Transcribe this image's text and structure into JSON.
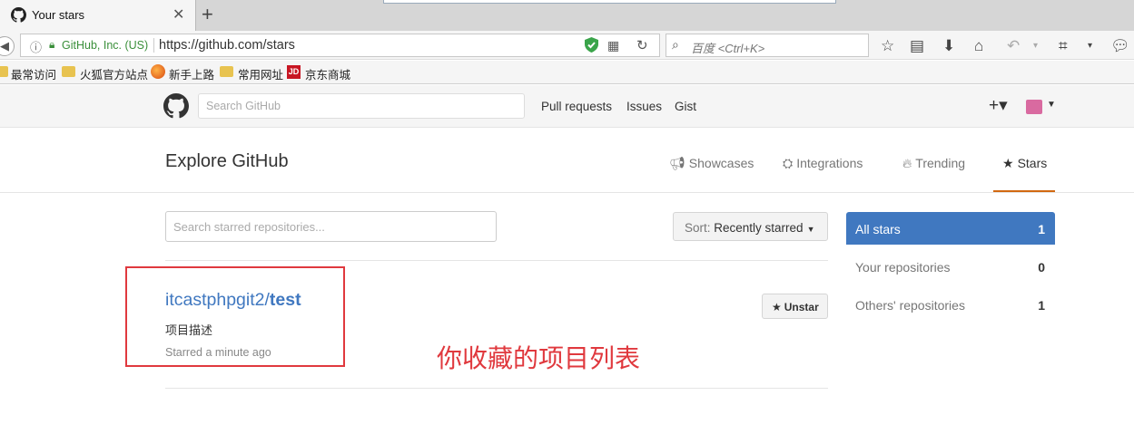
{
  "browser": {
    "tab_title": "Your stars",
    "new_tab": "+",
    "close": "✕",
    "identity": "GitHub, Inc. (US)",
    "url": "https://github.com/stars",
    "search_placeholder": "百度 <Ctrl+K>",
    "bookmarks": [
      "最常访问",
      "火狐官方站点",
      "新手上路",
      "常用网址",
      "京东商城"
    ],
    "jd_label": "JD"
  },
  "header": {
    "search_placeholder": "Search GitHub",
    "nav": [
      "Pull requests",
      "Issues",
      "Gist"
    ],
    "plus": "+▾"
  },
  "explore": {
    "title": "Explore GitHub",
    "tabs": [
      {
        "label": "Showcases",
        "icon": "megaphone-icon"
      },
      {
        "label": "Integrations",
        "icon": "plug-icon"
      },
      {
        "label": "Trending",
        "icon": "flame-icon"
      },
      {
        "label": "Stars",
        "icon": "star-icon"
      }
    ]
  },
  "main": {
    "search_placeholder": "Search starred repositories...",
    "sort_prefix": "Sort: ",
    "sort_value": "Recently starred",
    "repo": {
      "owner": "itcastphpgit2",
      "slash": "/",
      "name": "test",
      "description": "项目描述",
      "starred_time": "Starred a minute ago"
    },
    "unstar_label": "Unstar",
    "annotation": "你收藏的项目列表"
  },
  "sidebar": {
    "items": [
      {
        "label": "All stars",
        "count": "1"
      },
      {
        "label": "Your repositories",
        "count": "0"
      },
      {
        "label": "Others' repositories",
        "count": "1"
      }
    ]
  },
  "colors": {
    "link": "#4078c0",
    "active_tab_underline": "#d26911",
    "annotation_red": "#e0393e"
  }
}
